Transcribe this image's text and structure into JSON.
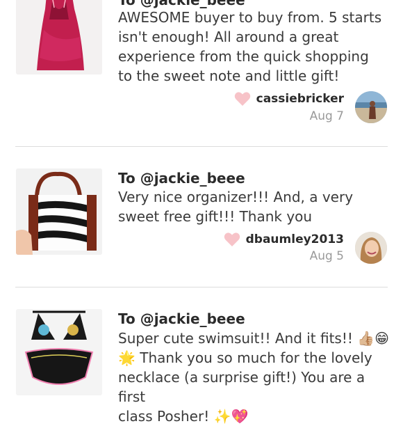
{
  "reviews": [
    {
      "to": "To @jackie_beee",
      "message": "AWESOME buyer to buy from. 5 starts isn't enough! All around a great experience from the quick shopping to the sweet note and little gift!",
      "username": "cassiebricker",
      "date": "Aug 7",
      "thumb_icon": "pink-satin-slip-photo",
      "avatar_icon": "beach-portrait-photo"
    },
    {
      "to": "To @jackie_beee",
      "message": "Very nice organizer!!! And, a very sweet free gift!!! Thank you",
      "username": "dbaumley2013",
      "date": "Aug 5",
      "thumb_icon": "zebra-tote-organizer-photo",
      "avatar_icon": "smiling-woman-portrait-photo"
    },
    {
      "to": "To @jackie_beee",
      "message_line1": "Super cute swimsuit!! And it fits!! 👍🏼😁",
      "message_line2": "🌟 Thank you so much for the lovely",
      "message_line3": "necklace (a surprise gift!) You are a first",
      "message_line4": "class Posher! ✨💖",
      "thumb_icon": "black-bikini-photo"
    }
  ],
  "colors": {
    "heart": "#f7c3c8",
    "text": "#3a3a3a",
    "muted": "#9a9a9a",
    "divider": "#dcdcdc"
  }
}
